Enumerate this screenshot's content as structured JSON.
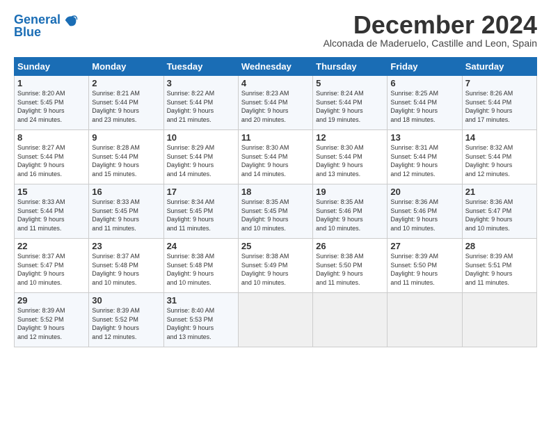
{
  "logo": {
    "line1": "General",
    "line2": "Blue"
  },
  "title": "December 2024",
  "subtitle": "Alconada de Maderuelo, Castille and Leon, Spain",
  "days_of_week": [
    "Sunday",
    "Monday",
    "Tuesday",
    "Wednesday",
    "Thursday",
    "Friday",
    "Saturday"
  ],
  "weeks": [
    [
      {
        "day": "1",
        "lines": [
          "Sunrise: 8:20 AM",
          "Sunset: 5:45 PM",
          "Daylight: 9 hours",
          "and 24 minutes."
        ]
      },
      {
        "day": "2",
        "lines": [
          "Sunrise: 8:21 AM",
          "Sunset: 5:44 PM",
          "Daylight: 9 hours",
          "and 23 minutes."
        ]
      },
      {
        "day": "3",
        "lines": [
          "Sunrise: 8:22 AM",
          "Sunset: 5:44 PM",
          "Daylight: 9 hours",
          "and 21 minutes."
        ]
      },
      {
        "day": "4",
        "lines": [
          "Sunrise: 8:23 AM",
          "Sunset: 5:44 PM",
          "Daylight: 9 hours",
          "and 20 minutes."
        ]
      },
      {
        "day": "5",
        "lines": [
          "Sunrise: 8:24 AM",
          "Sunset: 5:44 PM",
          "Daylight: 9 hours",
          "and 19 minutes."
        ]
      },
      {
        "day": "6",
        "lines": [
          "Sunrise: 8:25 AM",
          "Sunset: 5:44 PM",
          "Daylight: 9 hours",
          "and 18 minutes."
        ]
      },
      {
        "day": "7",
        "lines": [
          "Sunrise: 8:26 AM",
          "Sunset: 5:44 PM",
          "Daylight: 9 hours",
          "and 17 minutes."
        ]
      }
    ],
    [
      {
        "day": "8",
        "lines": [
          "Sunrise: 8:27 AM",
          "Sunset: 5:44 PM",
          "Daylight: 9 hours",
          "and 16 minutes."
        ]
      },
      {
        "day": "9",
        "lines": [
          "Sunrise: 8:28 AM",
          "Sunset: 5:44 PM",
          "Daylight: 9 hours",
          "and 15 minutes."
        ]
      },
      {
        "day": "10",
        "lines": [
          "Sunrise: 8:29 AM",
          "Sunset: 5:44 PM",
          "Daylight: 9 hours",
          "and 14 minutes."
        ]
      },
      {
        "day": "11",
        "lines": [
          "Sunrise: 8:30 AM",
          "Sunset: 5:44 PM",
          "Daylight: 9 hours",
          "and 14 minutes."
        ]
      },
      {
        "day": "12",
        "lines": [
          "Sunrise: 8:30 AM",
          "Sunset: 5:44 PM",
          "Daylight: 9 hours",
          "and 13 minutes."
        ]
      },
      {
        "day": "13",
        "lines": [
          "Sunrise: 8:31 AM",
          "Sunset: 5:44 PM",
          "Daylight: 9 hours",
          "and 12 minutes."
        ]
      },
      {
        "day": "14",
        "lines": [
          "Sunrise: 8:32 AM",
          "Sunset: 5:44 PM",
          "Daylight: 9 hours",
          "and 12 minutes."
        ]
      }
    ],
    [
      {
        "day": "15",
        "lines": [
          "Sunrise: 8:33 AM",
          "Sunset: 5:44 PM",
          "Daylight: 9 hours",
          "and 11 minutes."
        ]
      },
      {
        "day": "16",
        "lines": [
          "Sunrise: 8:33 AM",
          "Sunset: 5:45 PM",
          "Daylight: 9 hours",
          "and 11 minutes."
        ]
      },
      {
        "day": "17",
        "lines": [
          "Sunrise: 8:34 AM",
          "Sunset: 5:45 PM",
          "Daylight: 9 hours",
          "and 11 minutes."
        ]
      },
      {
        "day": "18",
        "lines": [
          "Sunrise: 8:35 AM",
          "Sunset: 5:45 PM",
          "Daylight: 9 hours",
          "and 10 minutes."
        ]
      },
      {
        "day": "19",
        "lines": [
          "Sunrise: 8:35 AM",
          "Sunset: 5:46 PM",
          "Daylight: 9 hours",
          "and 10 minutes."
        ]
      },
      {
        "day": "20",
        "lines": [
          "Sunrise: 8:36 AM",
          "Sunset: 5:46 PM",
          "Daylight: 9 hours",
          "and 10 minutes."
        ]
      },
      {
        "day": "21",
        "lines": [
          "Sunrise: 8:36 AM",
          "Sunset: 5:47 PM",
          "Daylight: 9 hours",
          "and 10 minutes."
        ]
      }
    ],
    [
      {
        "day": "22",
        "lines": [
          "Sunrise: 8:37 AM",
          "Sunset: 5:47 PM",
          "Daylight: 9 hours",
          "and 10 minutes."
        ]
      },
      {
        "day": "23",
        "lines": [
          "Sunrise: 8:37 AM",
          "Sunset: 5:48 PM",
          "Daylight: 9 hours",
          "and 10 minutes."
        ]
      },
      {
        "day": "24",
        "lines": [
          "Sunrise: 8:38 AM",
          "Sunset: 5:48 PM",
          "Daylight: 9 hours",
          "and 10 minutes."
        ]
      },
      {
        "day": "25",
        "lines": [
          "Sunrise: 8:38 AM",
          "Sunset: 5:49 PM",
          "Daylight: 9 hours",
          "and 10 minutes."
        ]
      },
      {
        "day": "26",
        "lines": [
          "Sunrise: 8:38 AM",
          "Sunset: 5:50 PM",
          "Daylight: 9 hours",
          "and 11 minutes."
        ]
      },
      {
        "day": "27",
        "lines": [
          "Sunrise: 8:39 AM",
          "Sunset: 5:50 PM",
          "Daylight: 9 hours",
          "and 11 minutes."
        ]
      },
      {
        "day": "28",
        "lines": [
          "Sunrise: 8:39 AM",
          "Sunset: 5:51 PM",
          "Daylight: 9 hours",
          "and 11 minutes."
        ]
      }
    ],
    [
      {
        "day": "29",
        "lines": [
          "Sunrise: 8:39 AM",
          "Sunset: 5:52 PM",
          "Daylight: 9 hours",
          "and 12 minutes."
        ]
      },
      {
        "day": "30",
        "lines": [
          "Sunrise: 8:39 AM",
          "Sunset: 5:52 PM",
          "Daylight: 9 hours",
          "and 12 minutes."
        ]
      },
      {
        "day": "31",
        "lines": [
          "Sunrise: 8:40 AM",
          "Sunset: 5:53 PM",
          "Daylight: 9 hours",
          "and 13 minutes."
        ]
      },
      null,
      null,
      null,
      null
    ]
  ]
}
